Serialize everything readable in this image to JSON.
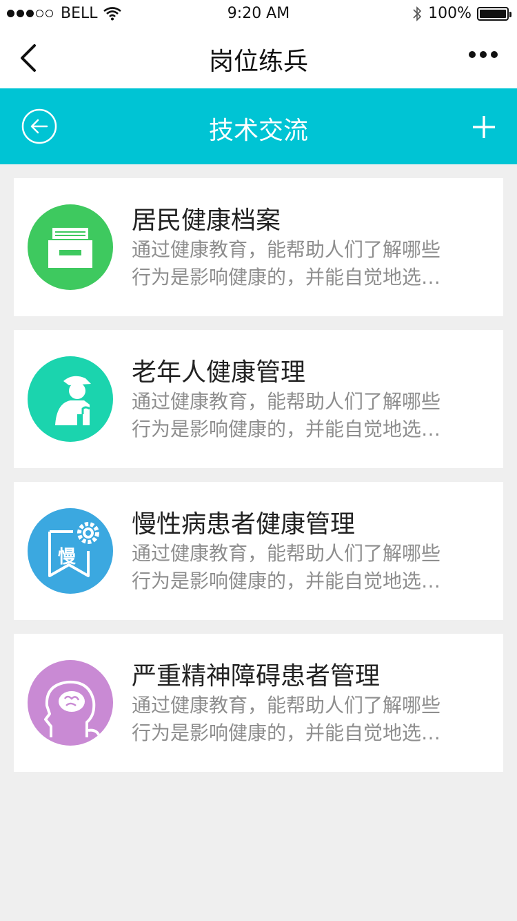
{
  "status_bar": {
    "carrier": "BELL",
    "time": "9:20 AM",
    "battery": "100%",
    "signal_bars_filled": 3,
    "signal_bars_total": 5
  },
  "nav": {
    "title": "岗位练兵",
    "back_icon": "chevron-left-icon",
    "more_icon": "more-dots-icon"
  },
  "sub_header": {
    "title": "技术交流",
    "back_icon": "circle-arrow-left-icon",
    "add_icon": "plus-icon",
    "background": "#00c4d4"
  },
  "items": [
    {
      "title": "居民健康档案",
      "desc_line1": "通过健康教育，能帮助人们了解哪些",
      "desc_line2": "行为是影响健康的，并能自觉地选…",
      "icon": "archive-box-icon",
      "color": "#3ec95f"
    },
    {
      "title": "老年人健康管理",
      "desc_line1": "通过健康教育，能帮助人们了解哪些",
      "desc_line2": "行为是影响健康的，并能自觉地选…",
      "icon": "elderly-person-icon",
      "color": "#1bd4ae"
    },
    {
      "title": "慢性病患者健康管理",
      "desc_line1": "通过健康教育，能帮助人们了解哪些",
      "desc_line2": "行为是影响健康的，并能自觉地选…",
      "icon": "chronic-disease-bookmark-gear-icon",
      "icon_text": "慢",
      "color": "#3ba8e0"
    },
    {
      "title": "严重精神障碍患者管理",
      "desc_line1": "通过健康教育，能帮助人们了解哪些",
      "desc_line2": "行为是影响健康的，并能自觉地选…",
      "icon": "head-brain-icon",
      "color": "#c98ad4"
    }
  ]
}
